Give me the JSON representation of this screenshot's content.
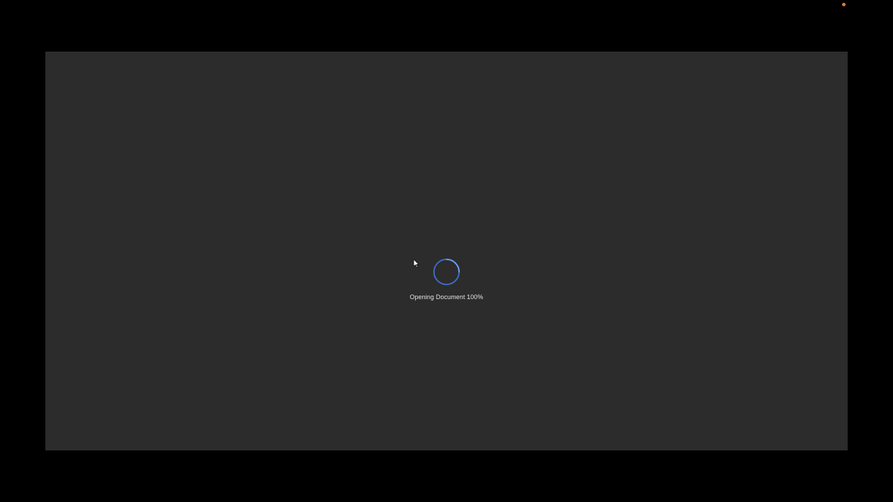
{
  "loader": {
    "label": "Opening Document",
    "percent": "100%",
    "spinner_color": "#4a7fd6"
  },
  "window": {
    "background": "#2c2c2c"
  },
  "status": {
    "dot_color": "#e07a2e"
  },
  "icons": {
    "spinner": "spinner-icon",
    "cursor": "mouse-cursor-icon"
  }
}
